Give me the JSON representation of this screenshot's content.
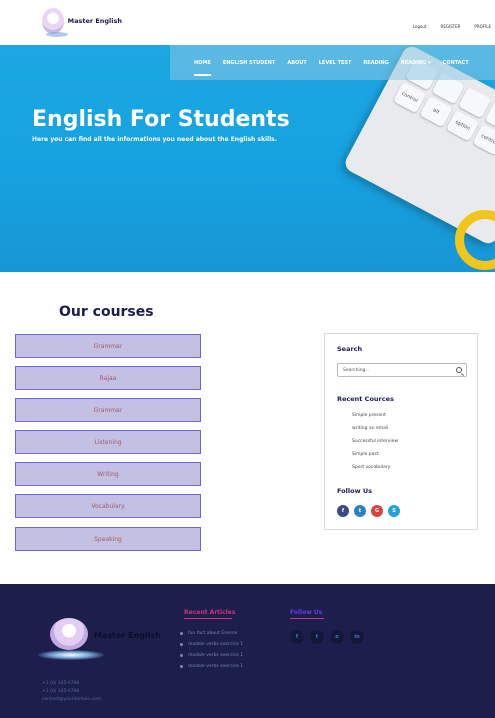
{
  "brand": {
    "name": "Master English"
  },
  "top_links": [
    "Logout",
    "REGISTER",
    "PROFILE"
  ],
  "nav": [
    "HOME",
    "ENGLISH STUDENT",
    "ABOUT",
    "LEVEL TEST",
    "READING",
    "READING",
    "CONTACT"
  ],
  "hero": {
    "title": "English For Students",
    "subtitle": "Here you can find all the informations you need about the English skills.",
    "keys": [
      "control",
      "alt",
      "option",
      "control"
    ]
  },
  "courses": {
    "title": "Our courses",
    "items": [
      "Grammar",
      "Rajaa",
      "Grammar",
      "Listening",
      "Writing",
      "Vocabulary",
      "Speaking"
    ]
  },
  "sidebar": {
    "search_heading": "Search",
    "search_placeholder": "Searching...",
    "recent_heading": "Recent Cources",
    "recent_items": [
      "Simple present",
      "writing an email",
      "Successful interview",
      "Simple past",
      "Sport vocabulary"
    ],
    "follow_heading": "Follow Us",
    "social": [
      {
        "icon": "facebook-icon",
        "glyph": "f",
        "color": "#3b4a86"
      },
      {
        "icon": "twitter-icon",
        "glyph": "t",
        "color": "#2f7fc7"
      },
      {
        "icon": "google-plus-icon",
        "glyph": "G",
        "color": "#d8443a"
      },
      {
        "icon": "skype-icon",
        "glyph": "S",
        "color": "#22a2d8"
      }
    ]
  },
  "footer": {
    "brand": "Master English",
    "contacts": [
      "+1 (0) 345 6789",
      "+1 (0) 345 6789",
      "contact@yourdomain.com"
    ],
    "articles_heading": "Recent Articles",
    "articles": [
      "fun fact about Greece",
      "modale verbs exercice 1",
      "modale verbs exercice 1",
      "modale verbs exercice 1"
    ],
    "follow_heading": "Follow Us",
    "social": [
      {
        "icon": "facebook-icon",
        "glyph": "f"
      },
      {
        "icon": "twitter-icon",
        "glyph": "t"
      },
      {
        "icon": "instagram-icon",
        "glyph": "o"
      },
      {
        "icon": "linkedin-icon",
        "glyph": "in"
      }
    ],
    "colors": {
      "background": "#1c1f4c",
      "accent": "#d0307d",
      "follow": "#5a3ce0"
    }
  }
}
